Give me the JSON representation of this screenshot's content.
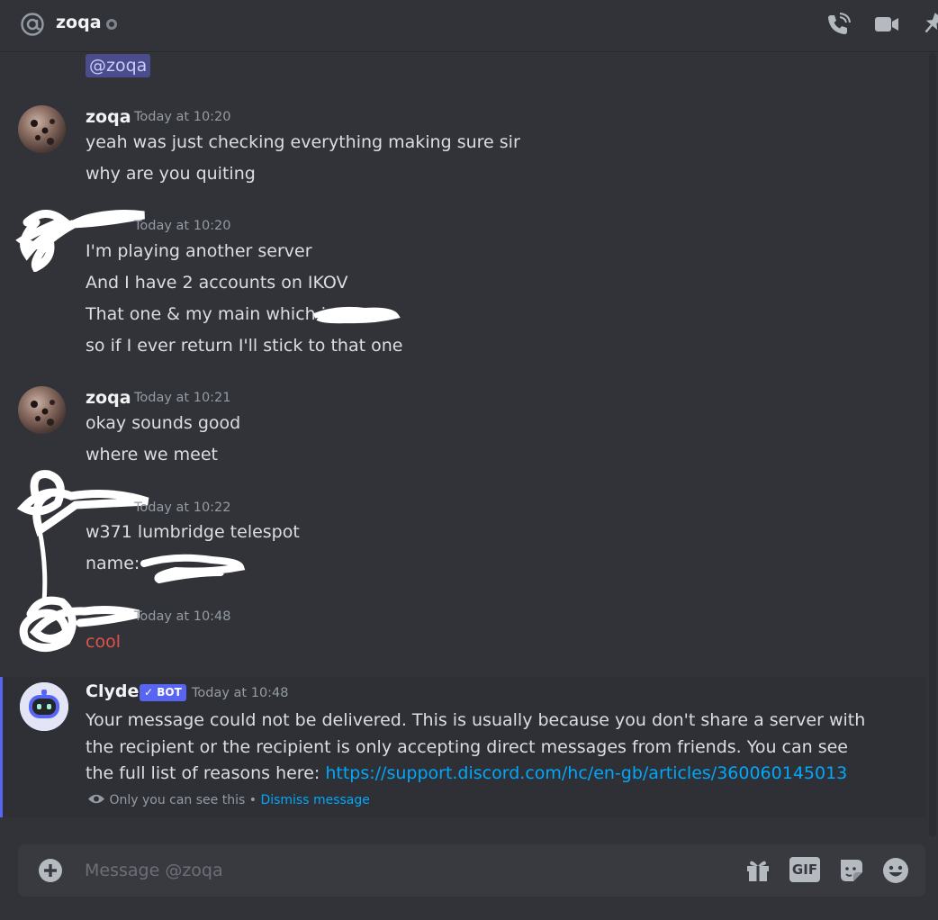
{
  "header": {
    "title": "zoqa",
    "icons": [
      "at-icon",
      "voice-call-icon",
      "video-call-icon",
      "pin-icon"
    ]
  },
  "mention": "@zoqa",
  "messages": [
    {
      "author": "zoqa",
      "timestamp": "Today at 10:20",
      "lines": [
        "yeah was just checking everything making sure sir",
        "why are you quiting"
      ]
    },
    {
      "author": "",
      "timestamp": "Today at 10:20",
      "lines": [
        "I'm playing another server",
        "And I have 2 accounts on IKOV",
        "That one & my main which is",
        "so if I ever return I'll stick to that one"
      ]
    },
    {
      "author": "zoqa",
      "timestamp": "Today at 10:21",
      "lines": [
        "okay sounds good",
        "where we meet"
      ]
    },
    {
      "author": "",
      "timestamp": "Today at 10:22",
      "lines": [
        "w371 lumbridge telespot",
        "name:"
      ]
    },
    {
      "author": "",
      "timestamp": "Today at 10:48",
      "lines": [
        "cool"
      ]
    }
  ],
  "clyde": {
    "author": "Clyde",
    "badge": "BOT",
    "badge_check": "✓",
    "timestamp": "Today at 10:48",
    "text": "Your message could not be delivered. This is usually because you don't share a server with the recipient or the recipient is only accepting direct messages from friends. You can see the full list of reasons here: ",
    "link": "https://support.discord.com/hc/en-gb/articles/360060145013",
    "ephemeral_note": "Only you can see this",
    "separator": "•",
    "dismiss_label": "Dismiss message"
  },
  "composer": {
    "placeholder": "Message @zoqa",
    "gif_label": "GIF",
    "icons": [
      "plus-icon",
      "gift-icon",
      "gif-icon",
      "sticker-icon",
      "emoji-icon"
    ]
  },
  "colors": {
    "background": "#313338",
    "accent": "#5865f2",
    "link": "#00a8fc",
    "error_text": "#e0524d"
  }
}
